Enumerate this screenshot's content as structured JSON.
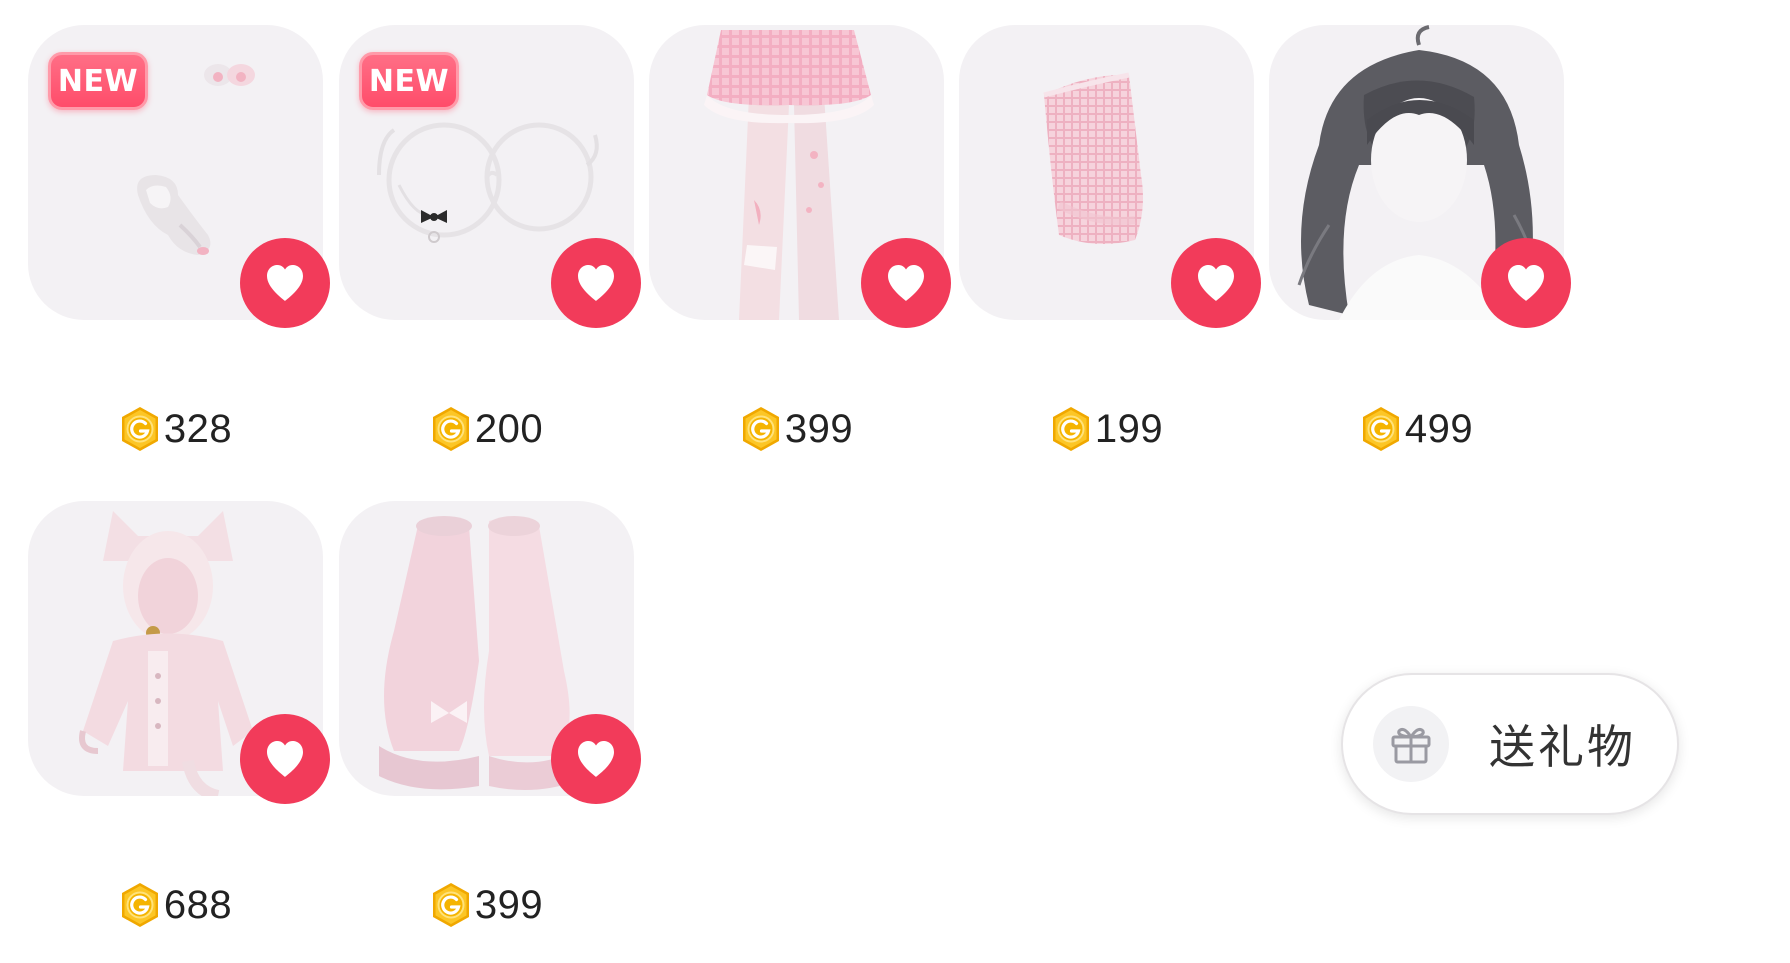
{
  "items": [
    {
      "price": "328",
      "badge": "NEW"
    },
    {
      "price": "200",
      "badge": "NEW"
    },
    {
      "price": "399"
    },
    {
      "price": "199"
    },
    {
      "price": "499"
    },
    {
      "price": "688"
    },
    {
      "price": "399"
    }
  ],
  "gift_button": {
    "label": "送礼物"
  },
  "colors": {
    "favorite": "#f23b5a",
    "new_badge": "#ff4c6a",
    "coin": "#f5b800",
    "card_background": "#f3f1f4"
  },
  "icons": {
    "favorite": "heart-icon",
    "currency": "coin-icon",
    "gift": "gift-icon"
  }
}
